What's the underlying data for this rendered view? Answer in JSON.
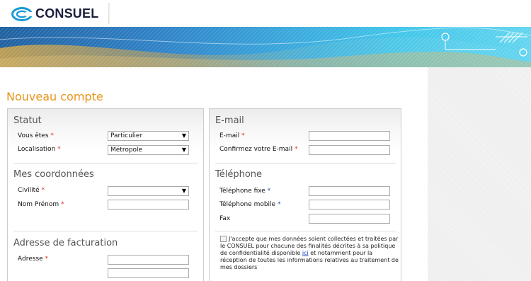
{
  "brand": {
    "name": "CONSUEL"
  },
  "page": {
    "title": "Nouveau compte"
  },
  "statut": {
    "title": "Statut",
    "vous_etes": {
      "label": "Vous êtes",
      "value": "Particulier"
    },
    "localisation": {
      "label": "Localisation",
      "value": "Métropole"
    }
  },
  "coordonnees": {
    "title": "Mes coordonnées",
    "civilite": {
      "label": "Civilité",
      "value": ""
    },
    "nom_prenom": {
      "label": "Nom Prénom"
    }
  },
  "facturation": {
    "title": "Adresse de facturation",
    "adresse": {
      "label": "Adresse"
    }
  },
  "email": {
    "title": "E-mail",
    "email": {
      "label": "E-mail"
    },
    "confirm": {
      "label": "Confirmez votre E-mail"
    }
  },
  "telephone": {
    "title": "Téléphone",
    "fixe": {
      "label": "Téléphone fixe"
    },
    "mobile": {
      "label": "Téléphone mobile"
    },
    "fax": {
      "label": "Fax"
    }
  },
  "consent": {
    "text_before": "J'accepte que mes données soient collectées et traitées par le CONSUEL pour chacune des finalités décrites à sa politique de confidentialité disponible ",
    "link": "ici",
    "text_after": " et notamment pour la réception de toutes les informations relatives au traitement de mes dossiers"
  },
  "symbols": {
    "required": "*",
    "dropdown": "▼"
  },
  "colors": {
    "title_orange": "#e8941a",
    "required_red": "#d9302a",
    "required_blue": "#1f4fa8",
    "brand_navy": "#1a1f3a",
    "banner_blue": "#35a7dc"
  }
}
